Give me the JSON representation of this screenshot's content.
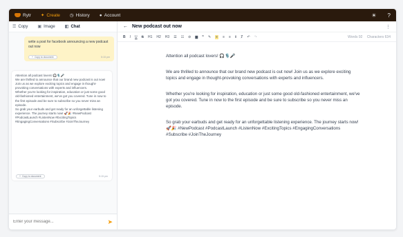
{
  "nav": {
    "logo": "Rytr",
    "create": "Create",
    "history": "History",
    "account": "Account"
  },
  "left": {
    "tabs": [
      {
        "label": "Copy"
      },
      {
        "label": "Image"
      },
      {
        "label": "Chat"
      }
    ],
    "user_message": {
      "text": "write a post for facebook announcing a new podcast out now",
      "copy_label": "Copy to document",
      "time": "5:15 pm"
    },
    "ai_message": {
      "text": "Attention all podcast lovers! 🎧🎙️🎤\nWe are thrilled to announce that our brand new podcast is out now! Join us as we explore exciting topics and engage in thought-provoking conversations with experts and influencers.\nWhether you're looking for inspiration, education or just some good old-fashioned entertainment, we've got you covered. Tune in now to the first episode and be sure to subscribe so you never miss an episode.\nSo grab your earbuds and get ready for an unforgettable listening experience. The journey starts now! 🚀🎉 #NewPodcast #PodcastLaunch #ListenNow #ExcitingTopics #EngagingConversations #Subscribe #JoinTheJourney",
      "copy_label": "Copy to document",
      "time": "5:15 pm"
    },
    "input_placeholder": "Enter your message..."
  },
  "doc": {
    "title": "New podcast out now",
    "toolbar": [
      "B",
      "I",
      "U",
      "S",
      "H1",
      "H2",
      "H3",
      "☰",
      "☷",
      "⊘",
      "▆",
      "❞",
      "✎",
      "≡",
      "≡",
      "≡",
      "Ⅱ",
      "Ⱦ",
      "↶",
      "↷"
    ],
    "words": "Words 92",
    "characters": "Characters 634",
    "paragraphs": [
      "Attention all podcast lovers! 🎧🎙️🎤",
      "We are thrilled to announce that our brand new podcast is out now! Join us as we explore exciting topics and engage in thought-provoking conversations with experts and influencers.",
      "Whether you're looking for inspiration, education or just some good old-fashioned entertainment, we've got you covered. Tune in now to the first episode and be sure to subscribe so you never miss an episode.",
      "So grab your earbuds and get ready for an unforgettable listening experience. The journey starts now! 🚀🎉 #NewPodcast #PodcastLaunch #ListenNow #ExcitingTopics #EngagingConversations #Subscribe #JoinTheJourney"
    ]
  },
  "colors": {
    "topbar": "#2a1a0d",
    "accent": "#f59e0b",
    "user_bubble": "#fef3c7"
  }
}
